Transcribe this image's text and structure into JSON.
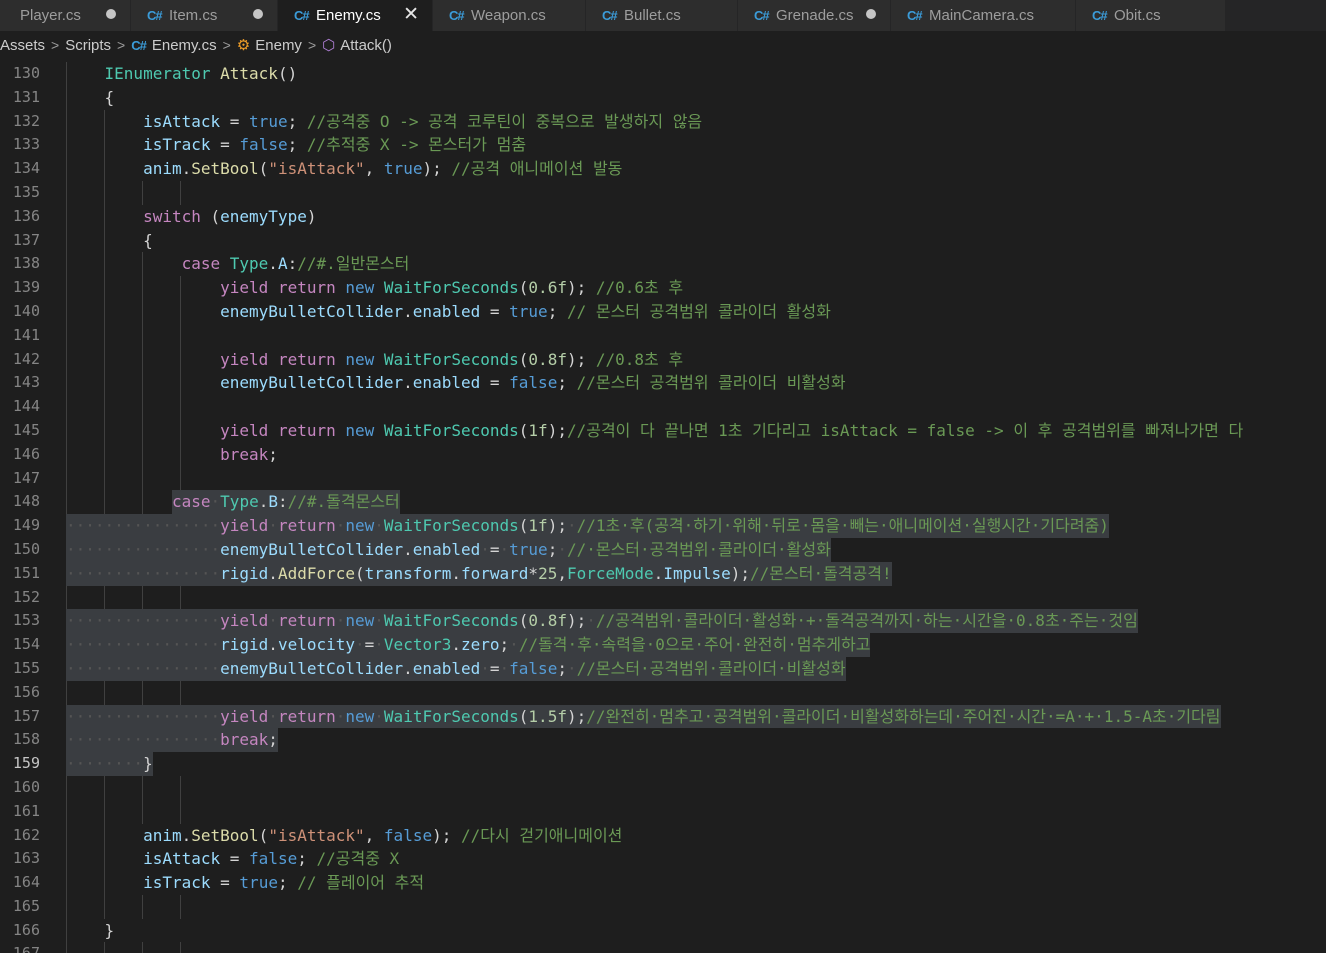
{
  "tabs": [
    {
      "label": "Player.cs",
      "dirty": true,
      "active": false
    },
    {
      "label": "Item.cs",
      "dirty": true,
      "active": false
    },
    {
      "label": "Enemy.cs",
      "dirty": false,
      "active": true
    },
    {
      "label": "Weapon.cs",
      "dirty": false,
      "active": false
    },
    {
      "label": "Bullet.cs",
      "dirty": false,
      "active": false
    },
    {
      "label": "Grenade.cs",
      "dirty": true,
      "active": false
    },
    {
      "label": "MainCamera.cs",
      "dirty": false,
      "active": false
    },
    {
      "label": "Obit.cs",
      "dirty": false,
      "active": false
    }
  ],
  "breadcrumb": {
    "items": [
      "Assets",
      "Scripts",
      "Enemy.cs",
      "Enemy",
      "Attack()"
    ]
  },
  "editor": {
    "current_line": 159,
    "lines": [
      {
        "n": 130,
        "code": "    IEnumerator Attack()"
      },
      {
        "n": 131,
        "code": "    {"
      },
      {
        "n": 132,
        "code": "        isAttack = true; //공격중 O -> 공격 코루틴이 중복으로 발생하지 않음"
      },
      {
        "n": 133,
        "code": "        isTrack = false; //추적중 X -> 몬스터가 멈춤"
      },
      {
        "n": 134,
        "code": "        anim.SetBool(\"isAttack\", true); //공격 애니메이션 발동"
      },
      {
        "n": 135,
        "code": ""
      },
      {
        "n": 136,
        "code": "        switch (enemyType)"
      },
      {
        "n": 137,
        "code": "        {"
      },
      {
        "n": 138,
        "code": "            case Type.A://#.일반몬스터"
      },
      {
        "n": 139,
        "code": "                yield return new WaitForSeconds(0.6f); //0.6초 후"
      },
      {
        "n": 140,
        "code": "                enemyBulletCollider.enabled = true; // 몬스터 공격범위 콜라이더 활성화"
      },
      {
        "n": 141,
        "code": ""
      },
      {
        "n": 142,
        "code": "                yield return new WaitForSeconds(0.8f); //0.8초 후"
      },
      {
        "n": 143,
        "code": "                enemyBulletCollider.enabled = false; //몬스터 공격범위 콜라이더 비활성화"
      },
      {
        "n": 144,
        "code": ""
      },
      {
        "n": 145,
        "code": "                yield return new WaitForSeconds(1f);//공격이 다 끝나면 1초 기다리고 isAttack = false -> 이 후 공격범위를 빠져나가면 다"
      },
      {
        "n": 146,
        "code": "                break;"
      },
      {
        "n": 147,
        "code": ""
      },
      {
        "n": 148,
        "code": "            case Type.B://#.돌격몬스터"
      },
      {
        "n": 149,
        "code": "                yield return new WaitForSeconds(1f); //1초 후(공격 하기 위해 뒤로 몸을 빼는 애니메이션 실행시간 기다려줌)"
      },
      {
        "n": 150,
        "code": "                enemyBulletCollider.enabled = true; // 몬스터 공격범위 콜라이더 활성화"
      },
      {
        "n": 151,
        "code": "                rigid.AddForce(transform.forward*25,ForceMode.Impulse);//몬스터 돌격공격!"
      },
      {
        "n": 152,
        "code": ""
      },
      {
        "n": 153,
        "code": "                yield return new WaitForSeconds(0.8f); //공격범위 콜라이더 활성화 + 돌격공격까지 하는 시간을 0.8초 주는 것임"
      },
      {
        "n": 154,
        "code": "                rigid.velocity = Vector3.zero; //돌격 후 속력을 0으로 주어 완전히 멈추게하고"
      },
      {
        "n": 155,
        "code": "                enemyBulletCollider.enabled = false; //몬스터 공격범위 콜라이더 비활성화"
      },
      {
        "n": 156,
        "code": ""
      },
      {
        "n": 157,
        "code": "                yield return new WaitForSeconds(1.5f);//완전히 멈추고 공격범위 콜라이더 비활성화하는데 주어진 시간 =A + 1.5-A초 기다림"
      },
      {
        "n": 158,
        "code": "                break;"
      },
      {
        "n": 159,
        "code": "        }"
      },
      {
        "n": 160,
        "code": ""
      },
      {
        "n": 161,
        "code": ""
      },
      {
        "n": 162,
        "code": "        anim.SetBool(\"isAttack\", false); //다시 걷기애니메이션"
      },
      {
        "n": 163,
        "code": "        isAttack = false; //공격중 X"
      },
      {
        "n": 164,
        "code": "        isTrack = true; // 플레이어 추적"
      },
      {
        "n": 165,
        "code": ""
      },
      {
        "n": 166,
        "code": "    }"
      },
      {
        "n": 167,
        "code": ""
      }
    ]
  }
}
